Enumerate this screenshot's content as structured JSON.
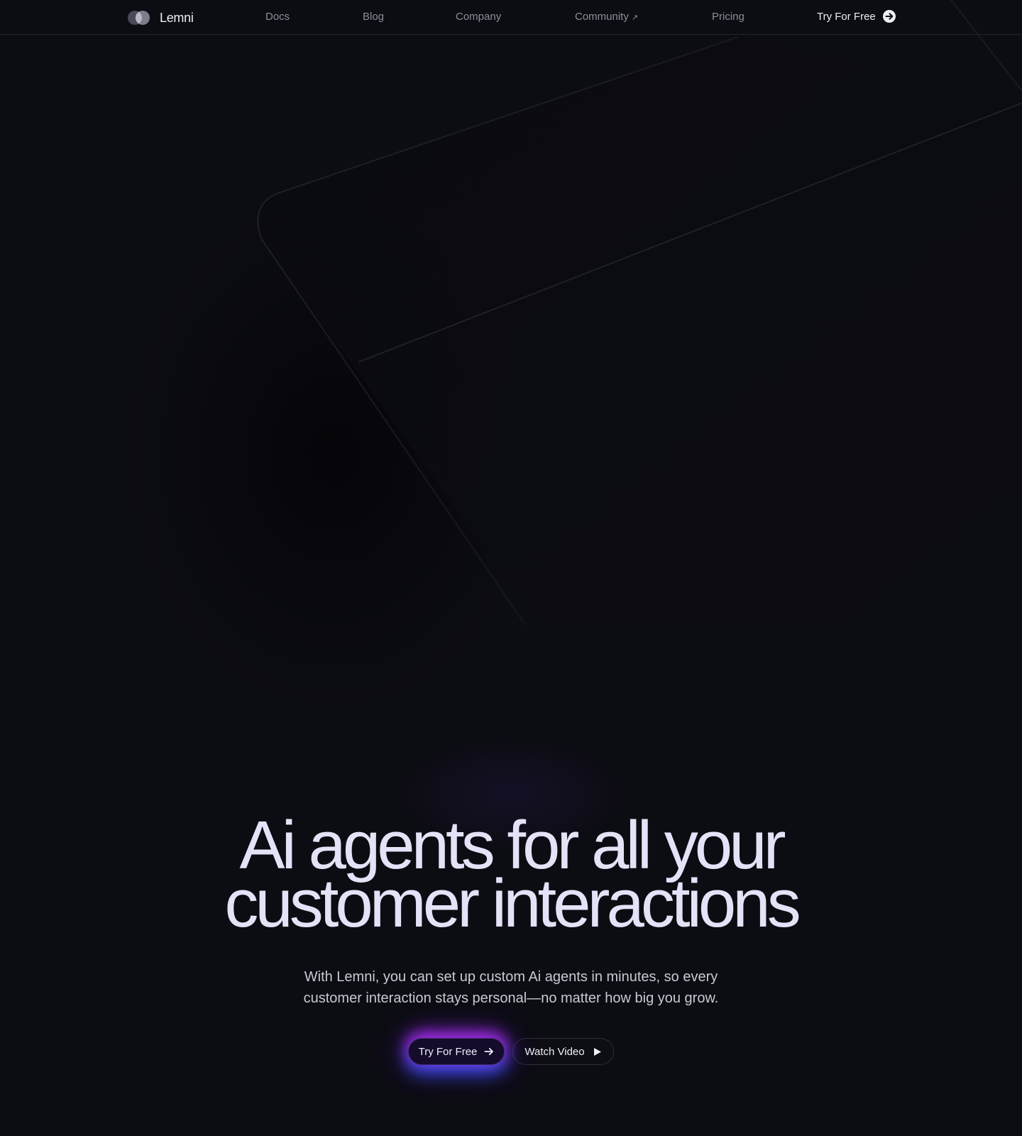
{
  "brand": {
    "name": "Lemni",
    "logo_icon": "overlapping-circles-logo"
  },
  "nav": {
    "links": [
      {
        "label": "Docs"
      },
      {
        "label": "Blog"
      },
      {
        "label": "Company"
      },
      {
        "label": "Community",
        "external_icon": "↗"
      },
      {
        "label": "Pricing"
      }
    ],
    "cta": {
      "label": "Try For Free",
      "icon": "circle-arrow-right-icon"
    }
  },
  "hero": {
    "title_line1": "Ai agents for all your",
    "title_line2": "customer interactions",
    "subtitle_line1": "With Lemni, you can set up custom Ai agents in minutes, so every",
    "subtitle_line2": "customer interaction stays personal—no matter how big you grow.",
    "primary_cta": {
      "label": "Try For Free",
      "icon": "arrow-right-icon"
    },
    "secondary_cta": {
      "label": "Watch Video",
      "icon": "play-icon"
    }
  },
  "colors": {
    "background": "#0c0c13",
    "nav_text": "#8d8d99",
    "title_text": "#e4e2f6",
    "glow_purple": "#c42cff",
    "glow_blue": "#285aff"
  }
}
